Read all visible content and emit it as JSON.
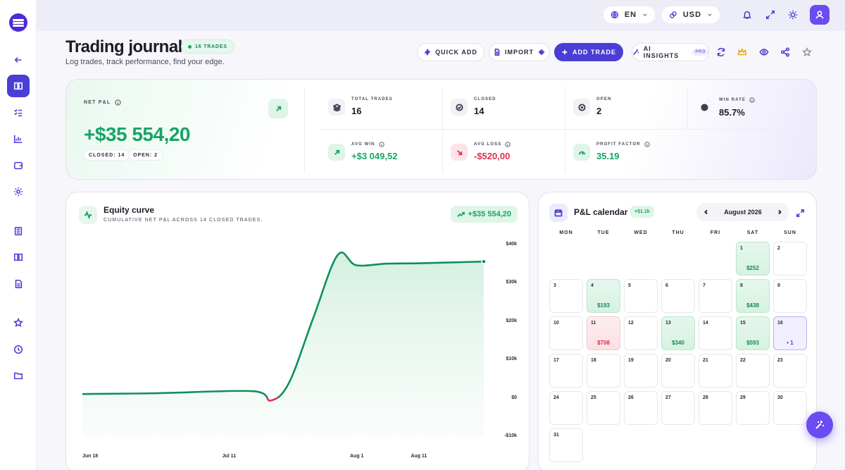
{
  "topbar": {
    "language": "EN",
    "currency": "USD"
  },
  "header": {
    "title": "Trading journal",
    "trades_badge": "16 TRADES",
    "subtitle": "Log trades, track performance, find your edge."
  },
  "actions": {
    "quick_add": "QUICK ADD",
    "import": "IMPORT",
    "add_trade": "ADD TRADE",
    "ai_insights": "AI INSIGHTS",
    "pro_badge": "PRO"
  },
  "stats": {
    "net_pnl_label": "NET P&L",
    "net_pnl_value": "+$35 554,20",
    "closed_chip": "CLOSED: 14",
    "open_chip": "OPEN: 2",
    "total_trades_label": "TOTAL TRADES",
    "total_trades_value": "16",
    "closed_label": "CLOSED",
    "closed_value": "14",
    "open_label": "OPEN",
    "open_value": "2",
    "win_rate_label": "WIN RATE",
    "win_rate_value": "85.7%",
    "avg_win_label": "AVG WIN",
    "avg_win_value": "+$3 049,52",
    "avg_loss_label": "AVG LOSS",
    "avg_loss_value": "-$520,00",
    "profit_factor_label": "PROFIT FACTOR",
    "profit_factor_value": "35.19"
  },
  "equity": {
    "title": "Equity curve",
    "subtitle": "CUMULATIVE NET P&L ACROSS 14 CLOSED TRADES.",
    "badge": "+$35 554,20"
  },
  "chart_data": {
    "type": "area",
    "title": "Equity curve",
    "x_tick_labels": [
      "Jun 18",
      "Jul 11",
      "Aug 1",
      "Aug 11"
    ],
    "y_tick_labels": [
      "$40k",
      "$30k",
      "$20k",
      "$10k",
      "$0",
      "-$10k"
    ],
    "ylim": [
      -10000,
      40000
    ],
    "x_day_range": [
      0,
      66
    ],
    "x_tick_days": [
      0,
      23,
      44,
      54
    ],
    "grid": false,
    "series": [
      {
        "points": [
          {
            "day": 0,
            "value": 1000
          },
          {
            "day": 12,
            "value": 1200
          },
          {
            "day": 28,
            "value": 1750
          },
          {
            "day": 31,
            "value": -700
          },
          {
            "day": 34,
            "value": 4000
          },
          {
            "day": 38,
            "value": 21000
          },
          {
            "day": 42,
            "value": 37300
          },
          {
            "day": 45,
            "value": 34600
          },
          {
            "day": 50,
            "value": 35000
          },
          {
            "day": 55,
            "value": 35100
          },
          {
            "day": 60,
            "value": 35300
          },
          {
            "day": 66,
            "value": 35554.2
          }
        ]
      }
    ]
  },
  "calendar": {
    "title": "P&L calendar",
    "badge": "+$1.1k",
    "month": "August 2026",
    "weekdays": [
      "MON",
      "TUE",
      "WED",
      "THU",
      "FRI",
      "SAT",
      "SUN"
    ],
    "first_weekday": 5,
    "days": 31,
    "entries": [
      {
        "day": 1,
        "value": "$252",
        "kind": "win"
      },
      {
        "day": 4,
        "value": "$193",
        "kind": "win"
      },
      {
        "day": 8,
        "value": "$438",
        "kind": "win"
      },
      {
        "day": 11,
        "value": "$708",
        "kind": "loss"
      },
      {
        "day": 13,
        "value": "$340",
        "kind": "win"
      },
      {
        "day": 15,
        "value": "$593",
        "kind": "win"
      },
      {
        "day": 16,
        "value": "• 1",
        "kind": "today"
      }
    ]
  }
}
